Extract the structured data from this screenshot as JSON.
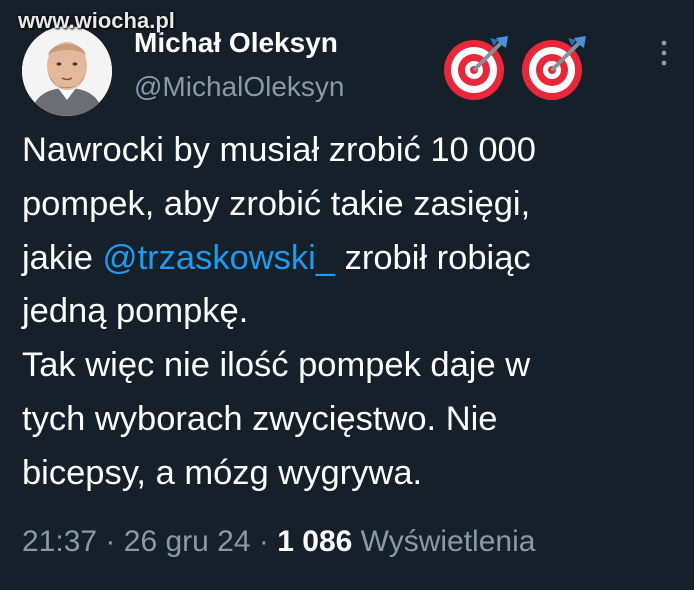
{
  "watermark": "www.wiocha.pl",
  "author": {
    "display_name": "Michał Oleksyn",
    "handle": "@MichalOleksyn",
    "emojis": [
      "direct-hit-icon",
      "direct-hit-icon"
    ]
  },
  "tweet": {
    "lines": [
      {
        "before": "Nawrocki by musiał zrobić 10 000",
        "mention": "",
        "after": ""
      },
      {
        "before": "pompek, aby zrobić takie zasięgi,",
        "mention": "",
        "after": ""
      },
      {
        "before": "jakie ",
        "mention": "@trzaskowski_",
        "after": " zrobił robiąc"
      },
      {
        "before": "jedną pompkę.",
        "mention": "",
        "after": ""
      },
      {
        "before": "Tak więc nie ilość pompek daje w",
        "mention": "",
        "after": ""
      },
      {
        "before": "tych wyborach zwycięstwo. Nie",
        "mention": "",
        "after": ""
      },
      {
        "before": "bicepsy, a mózg wygrywa.",
        "mention": "",
        "after": ""
      }
    ]
  },
  "meta": {
    "time": "21:37",
    "separator": "·",
    "date": "26 gru 24",
    "views_count": "1 086",
    "views_label": "Wyświetlenia"
  },
  "colors": {
    "background": "#15202b",
    "text": "#ffffff",
    "secondary": "#8b98a5",
    "mention": "#1d9bf0"
  }
}
